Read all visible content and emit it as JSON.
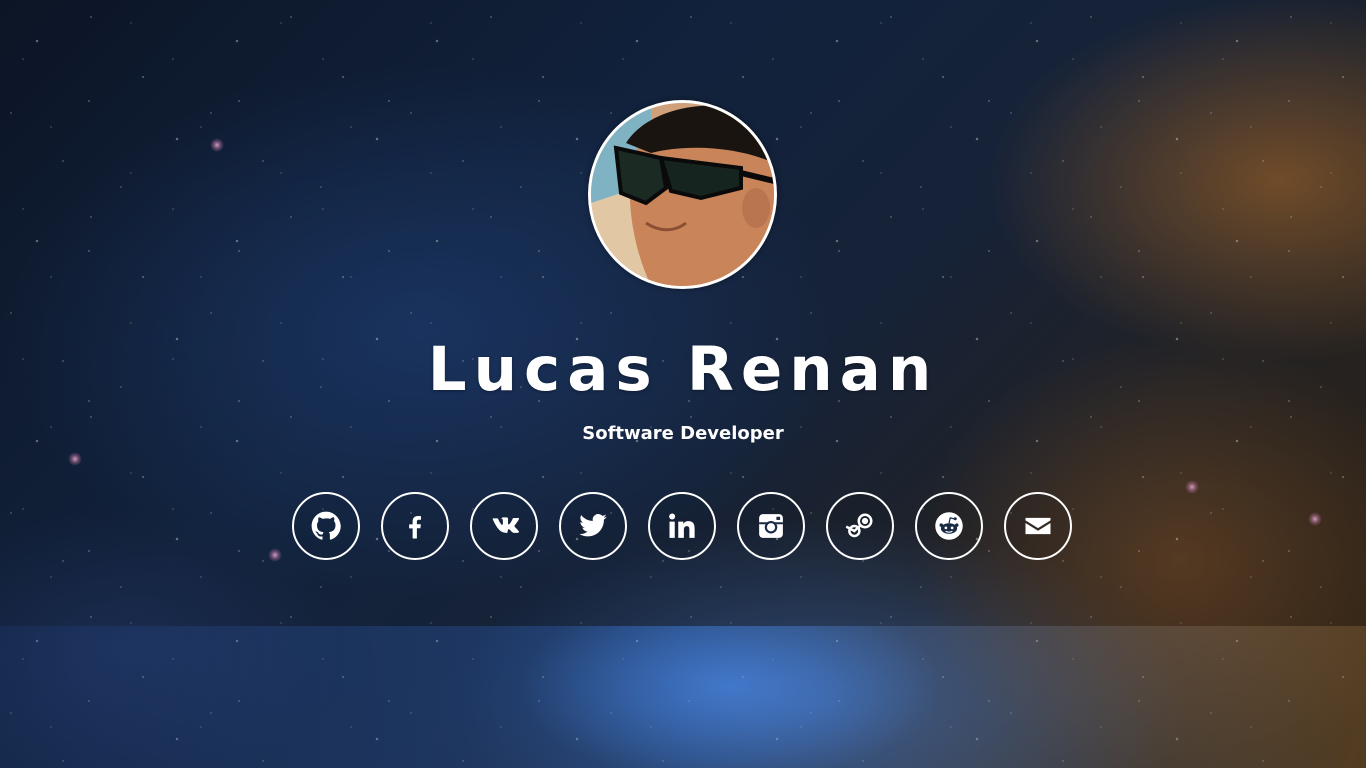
{
  "profile": {
    "name": "Lucas Renan",
    "role": "Software Developer"
  },
  "social_links": [
    {
      "name": "github",
      "icon": "github-icon"
    },
    {
      "name": "facebook",
      "icon": "facebook-icon"
    },
    {
      "name": "vk",
      "icon": "vk-icon"
    },
    {
      "name": "twitter",
      "icon": "twitter-icon"
    },
    {
      "name": "linkedin",
      "icon": "linkedin-icon"
    },
    {
      "name": "instagram",
      "icon": "instagram-icon"
    },
    {
      "name": "steam",
      "icon": "steam-icon"
    },
    {
      "name": "reddit",
      "icon": "reddit-icon"
    },
    {
      "name": "email",
      "icon": "envelope-icon"
    }
  ],
  "colors": {
    "text": "#ffffff",
    "icon_border": "#ffffff"
  }
}
